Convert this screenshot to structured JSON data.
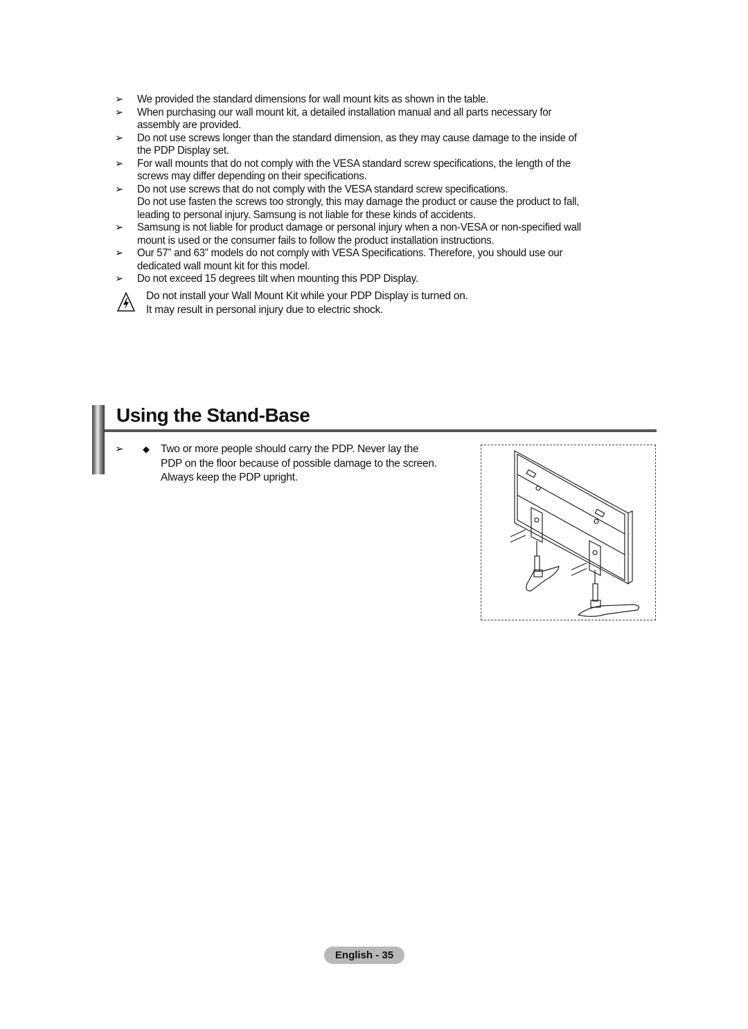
{
  "notes": [
    {
      "lines": [
        "We provided the standard dimensions for wall mount kits as shown in the table."
      ]
    },
    {
      "lines": [
        "When purchasing our wall mount kit, a detailed installation manual and all parts necessary for",
        "assembly are provided."
      ]
    },
    {
      "lines": [
        "Do not use screws longer than the standard dimension, as they may cause damage to the inside of",
        "the PDP Display set."
      ]
    },
    {
      "lines": [
        "For wall mounts that do not comply with the VESA standard screw specifications, the length of the",
        "screws may differ depending on their specifications."
      ]
    },
    {
      "lines": [
        "Do not use screws that do not comply with the VESA standard screw specifications.",
        "Do not use fasten the screws too strongly, this may damage the product or cause the product to fall,",
        "leading to personal injury. Samsung is not liable for these kinds of accidents."
      ]
    },
    {
      "lines": [
        "Samsung is not liable for product damage or personal injury when a non-VESA or non-specified wall",
        "mount is used or the consumer fails to follow the product installation instructions."
      ]
    },
    {
      "lines": [
        "Our 57” and 63” models do not comply with VESA Specifications. Therefore, you should use our",
        "dedicated wall mount kit for this model."
      ]
    },
    {
      "lines": [
        "Do not exceed 15 degrees tilt when mounting this PDP Display."
      ]
    }
  ],
  "note_bullet_icon": "arrowhead-icon",
  "warning": {
    "icon": "electric-shock-warning-icon",
    "line1": "Do not install your Wall Mount Kit while your PDP Display is turned on.",
    "line2": "It may result in personal injury due to electric shock."
  },
  "section": {
    "title": "Using the Stand-Base",
    "note": {
      "bullet_icon": "arrowhead-icon",
      "sub_bullet_icon": "diamond-icon",
      "lines": [
        "Two or more people should carry the PDP. Never lay the",
        "PDP on the floor because of possible damage to the screen.",
        "Always keep the PDP upright."
      ]
    },
    "figure": "stand-base-assembly-illustration"
  },
  "footer": {
    "page_label": "English - 35"
  }
}
